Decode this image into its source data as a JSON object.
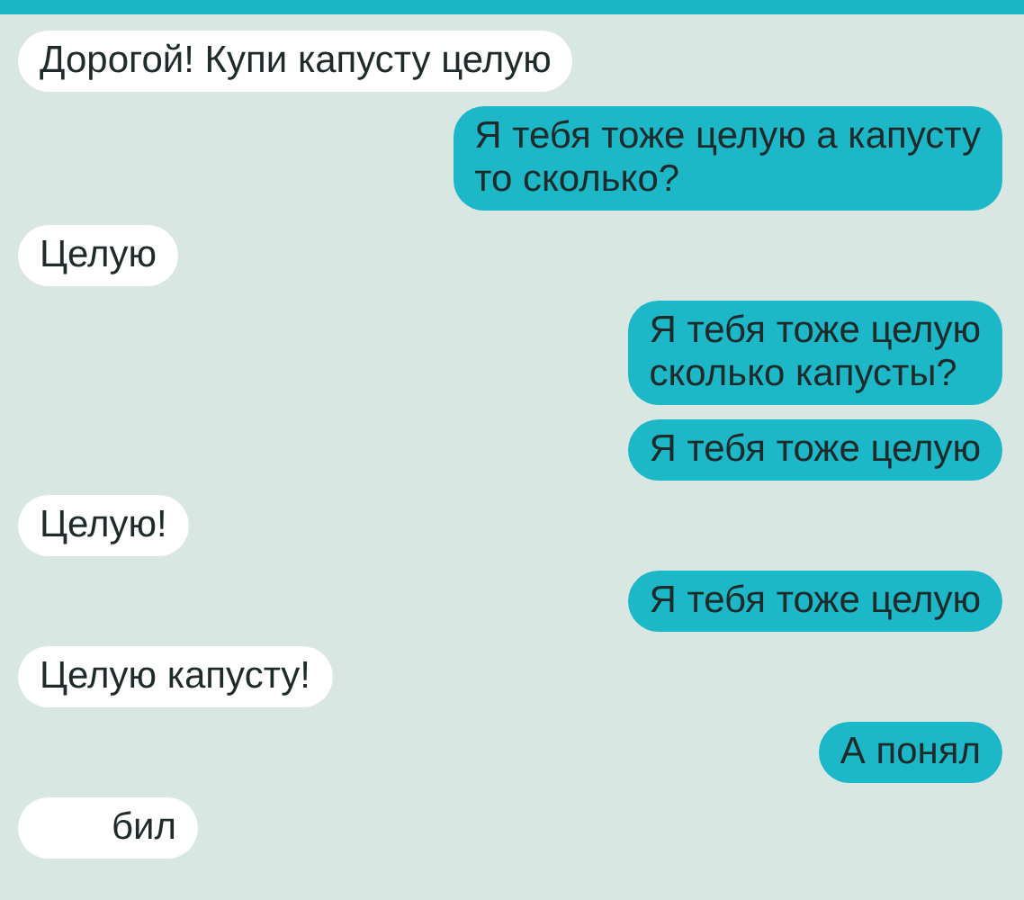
{
  "messages": [
    {
      "kind": "incoming",
      "text": "Дорогой! Купи капусту целую"
    },
    {
      "kind": "outgoing",
      "text": "Я тебя тоже целую а капусту\nто сколько?"
    },
    {
      "kind": "incoming",
      "text": "Целую"
    },
    {
      "kind": "outgoing",
      "text": "Я тебя тоже целую\nсколько капусты?"
    },
    {
      "kind": "outgoing",
      "text": "Я тебя тоже целую"
    },
    {
      "kind": "incoming",
      "text": "Целую!"
    },
    {
      "kind": "outgoing",
      "text": "Я тебя тоже целую"
    },
    {
      "kind": "incoming",
      "text": "Целую капусту!"
    },
    {
      "kind": "outgoing",
      "text": "А понял"
    },
    {
      "kind": "incoming",
      "text": "бил"
    }
  ]
}
